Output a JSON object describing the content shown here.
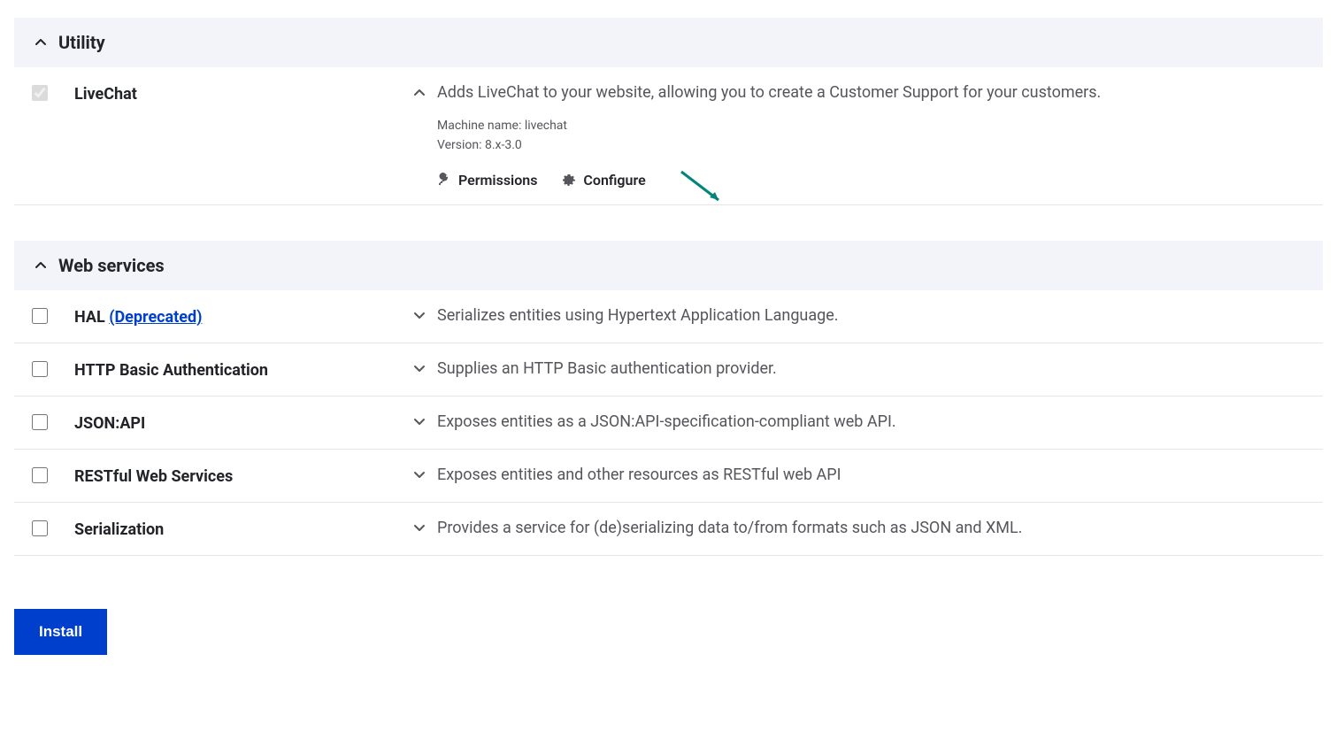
{
  "sections": [
    {
      "title": "Utility",
      "modules": [
        {
          "name": "LiveChat",
          "checked": true,
          "disabled": true,
          "deprecated": false,
          "description": "Adds LiveChat to your website, allowing you to create a Customer Support for your customers.",
          "expanded": true,
          "machine_name_label": "Machine name: ",
          "machine_name": "livechat",
          "version_label": "Version: ",
          "version": "8.x-3.0",
          "links": {
            "permissions": "Permissions",
            "configure": "Configure"
          }
        }
      ]
    },
    {
      "title": "Web services",
      "modules": [
        {
          "name": "HAL ",
          "deprecated_text": "(Deprecated)",
          "checked": false,
          "disabled": false,
          "deprecated": true,
          "description": "Serializes entities using Hypertext Application Language.",
          "expanded": false
        },
        {
          "name": "HTTP Basic Authentication",
          "checked": false,
          "disabled": false,
          "deprecated": false,
          "description": "Supplies an HTTP Basic authentication provider.",
          "expanded": false
        },
        {
          "name": "JSON:API",
          "checked": false,
          "disabled": false,
          "deprecated": false,
          "description": "Exposes entities as a JSON:API-specification-compliant web API.",
          "expanded": false
        },
        {
          "name": "RESTful Web Services",
          "checked": false,
          "disabled": false,
          "deprecated": false,
          "description": "Exposes entities and other resources as RESTful web API",
          "expanded": false
        },
        {
          "name": "Serialization",
          "checked": false,
          "disabled": false,
          "deprecated": false,
          "description": "Provides a service for (de)serializing data to/from formats such as JSON and XML.",
          "expanded": false
        }
      ]
    }
  ],
  "install_label": "Install"
}
